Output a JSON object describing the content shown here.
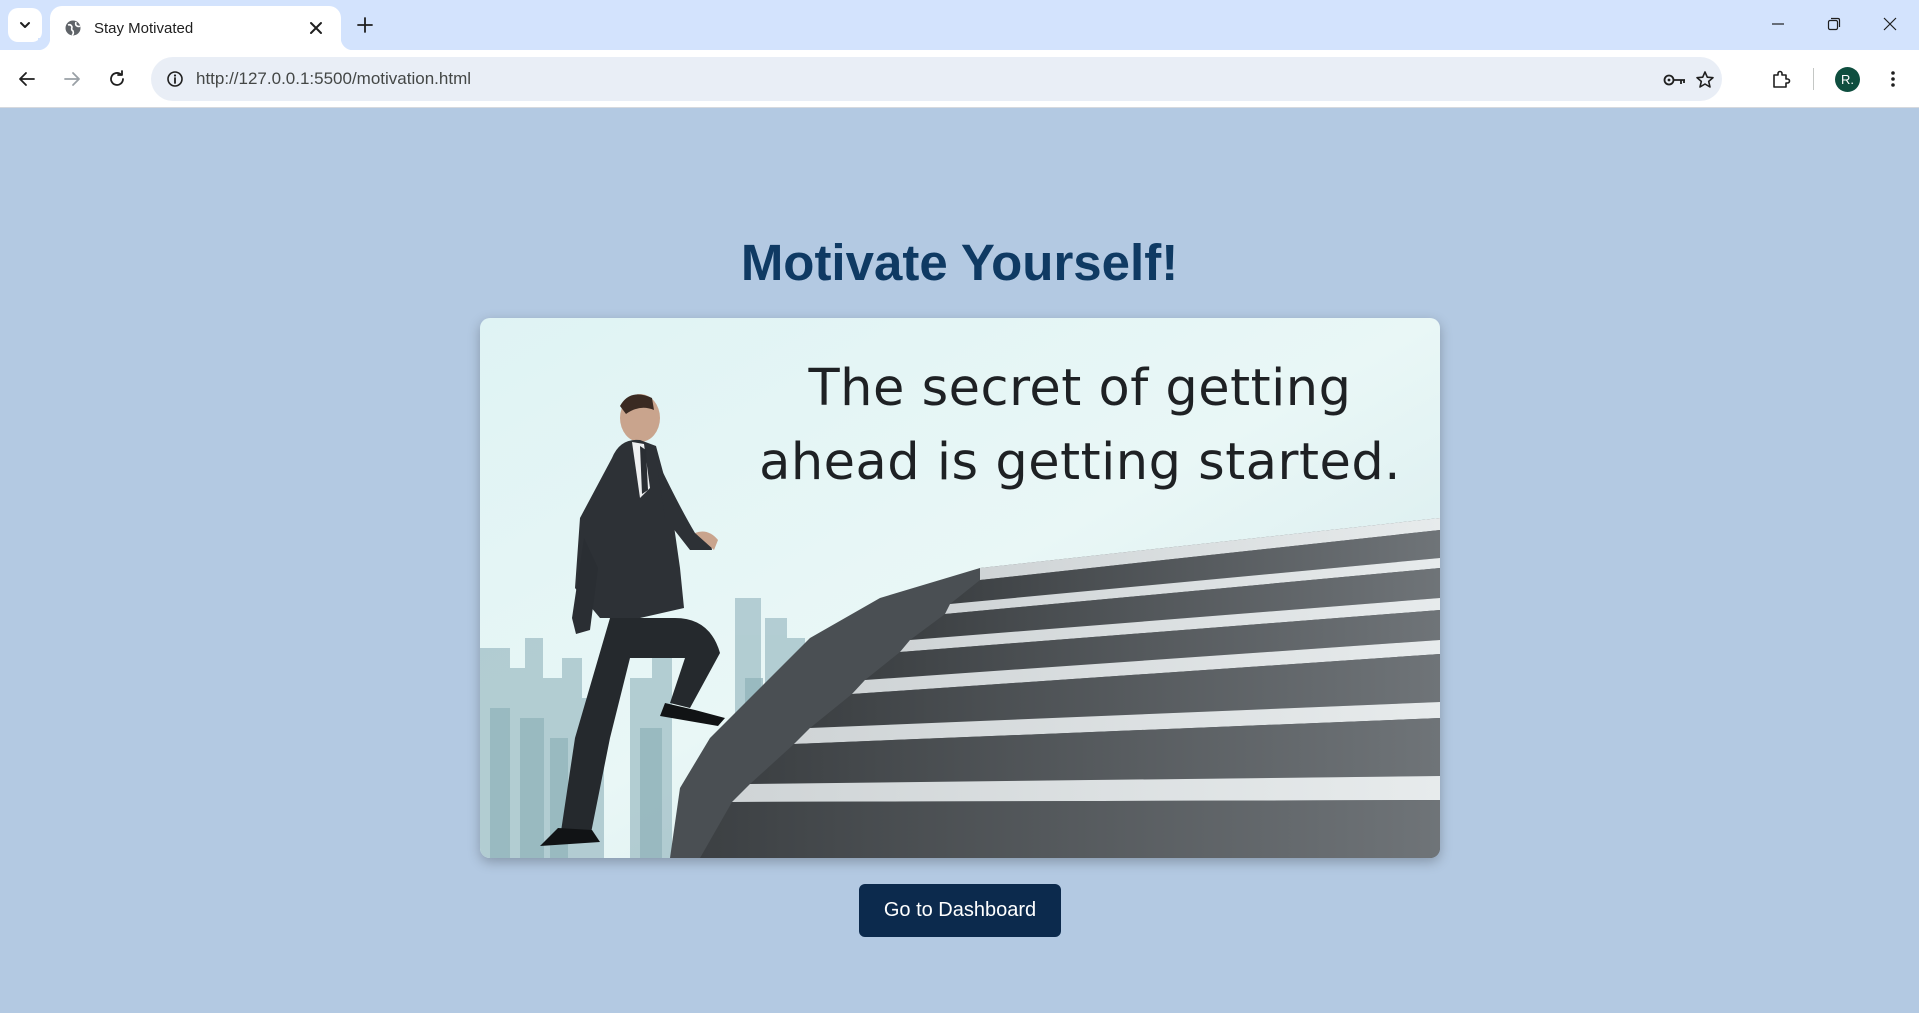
{
  "browser": {
    "tab": {
      "title": "Stay Motivated"
    },
    "address_bar": {
      "url": "http://127.0.0.1:5500/motivation.html"
    },
    "profile_initial": "R."
  },
  "page": {
    "heading": "Motivate Yourself!",
    "quote_line1": "The secret of getting",
    "quote_line2": "ahead is getting started.",
    "dashboard_button": "Go to Dashboard"
  },
  "colors": {
    "page_background": "#b3c9e2",
    "heading": "#0f3a63",
    "button": "#0c2a4d",
    "tab_strip": "#d3e3fd"
  }
}
